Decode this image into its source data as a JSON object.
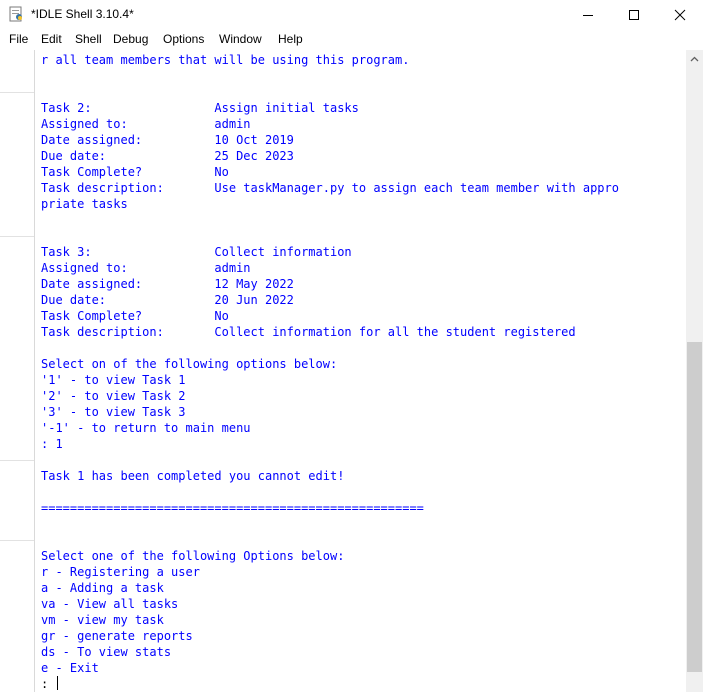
{
  "window": {
    "title": "*IDLE Shell 3.10.4*",
    "controls": [
      "minimize",
      "maximize",
      "close"
    ]
  },
  "menu": [
    "File",
    "Edit",
    "Shell",
    "Debug",
    "Options",
    "Window",
    "Help"
  ],
  "shell": {
    "lines": [
      "r all team members that will be using this program.",
      "",
      "",
      "Task 2:                 Assign initial tasks",
      "Assigned to:            admin",
      "Date assigned:          10 Oct 2019",
      "Due date:               25 Dec 2023",
      "Task Complete?          No",
      "Task description:       Use taskManager.py to assign each team member with appro",
      "priate tasks",
      "",
      "",
      "Task 3:                 Collect information",
      "Assigned to:            admin",
      "Date assigned:          12 May 2022",
      "Due date:               20 Jun 2022",
      "Task Complete?          No",
      "Task description:       Collect information for all the student registered",
      "",
      "Select on of the following options below:",
      "'1' - to view Task 1",
      "'2' - to view Task 2",
      "'3' - to view Task 3",
      "'-1' - to return to main menu",
      ": 1",
      "",
      "Task 1 has been completed you cannot edit!",
      "",
      "=====================================================",
      "",
      "",
      "Select one of the following Options below:",
      "r - Registering a user",
      "a - Adding a task",
      "va - View all tasks",
      "vm - view my task",
      "gr - generate reports",
      "ds - To view stats",
      "e - Exit"
    ],
    "prompt": ": "
  },
  "colors": {
    "output_text": "#0000ff",
    "background": "#ffffff",
    "scrollbar_track": "#f0f0f0",
    "scrollbar_thumb": "#cdcdcd"
  }
}
